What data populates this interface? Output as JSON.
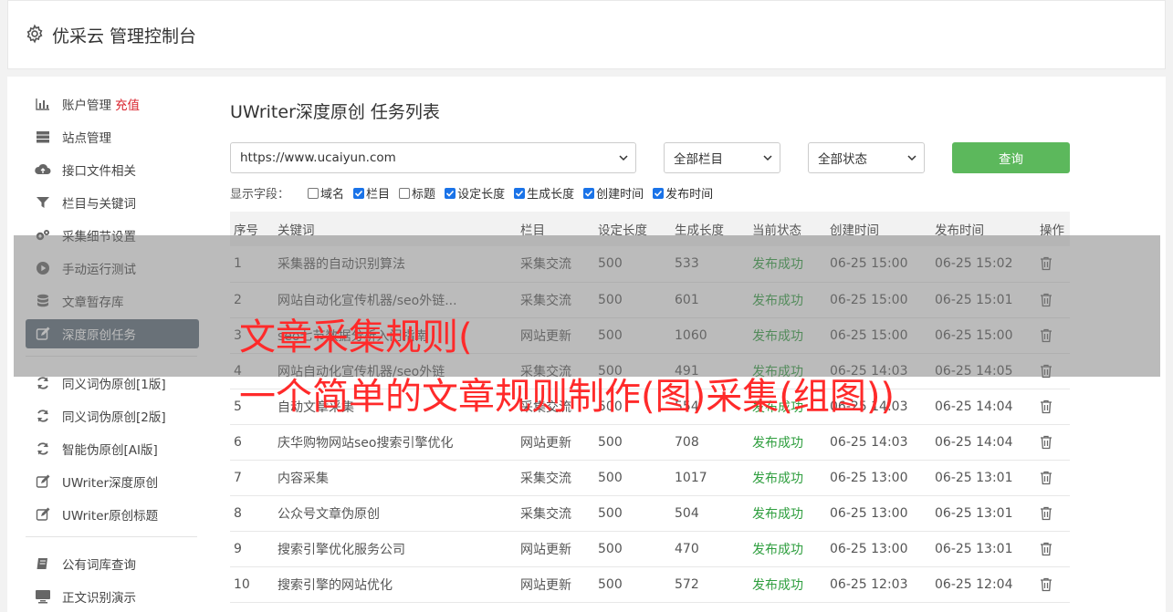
{
  "header": {
    "title": "优采云 管理控制台",
    "icon": "gear-icon"
  },
  "sidebar": {
    "group1": [
      {
        "label": "账户管理",
        "extra": "充值",
        "icon": "bar-chart-icon"
      },
      {
        "label": "站点管理",
        "icon": "server-icon"
      },
      {
        "label": "接口文件相关",
        "icon": "cloud-upload-icon"
      },
      {
        "label": "栏目与关键词",
        "icon": "filter-icon"
      },
      {
        "label": "采集细节设置",
        "icon": "gears-icon"
      },
      {
        "label": "手动运行测试",
        "icon": "play-circle-icon"
      },
      {
        "label": "文章暂存库",
        "icon": "database-icon"
      },
      {
        "label": "深度原创任务",
        "icon": "edit-icon",
        "active": true
      }
    ],
    "group2": [
      {
        "label": "同义词伪原创[1版]",
        "icon": "refresh-icon"
      },
      {
        "label": "同义词伪原创[2版]",
        "icon": "refresh-icon"
      },
      {
        "label": "智能伪原创[AI版]",
        "icon": "refresh-icon"
      },
      {
        "label": "UWriter深度原创",
        "icon": "edit-icon"
      },
      {
        "label": "UWriter原创标题",
        "icon": "edit-icon"
      }
    ],
    "group3": [
      {
        "label": "公有词库查询",
        "icon": "book-icon"
      },
      {
        "label": "正文识别演示",
        "icon": "monitor-icon"
      }
    ]
  },
  "main": {
    "title": "UWriter深度原创 任务列表",
    "site_select": "https://www.ucaiyun.com",
    "column_select": "全部栏目",
    "status_select": "全部状态",
    "query_button": "查询",
    "fields_label": "显示字段：",
    "fields": [
      {
        "label": "域名",
        "checked": false
      },
      {
        "label": "栏目",
        "checked": true
      },
      {
        "label": "标题",
        "checked": false
      },
      {
        "label": "设定长度",
        "checked": true
      },
      {
        "label": "生成长度",
        "checked": true
      },
      {
        "label": "创建时间",
        "checked": true
      },
      {
        "label": "发布时间",
        "checked": true
      }
    ],
    "table": {
      "headers": [
        "序号",
        "关键词",
        "栏目",
        "设定长度",
        "生成长度",
        "当前状态",
        "创建时间",
        "发布时间",
        "操作"
      ],
      "rows": [
        [
          "1",
          "采集器的自动识别算法",
          "采集交流",
          "500",
          "533",
          "发布成功",
          "06-25 15:00",
          "06-25 15:02"
        ],
        [
          "2",
          "网站自动化宣传机器/seo外链...",
          "采集交流",
          "500",
          "601",
          "发布成功",
          "06-25 15:00",
          "06-25 15:01"
        ],
        [
          "3",
          "seo七节数据分析入门指南",
          "网站更新",
          "500",
          "1060",
          "发布成功",
          "06-25 15:00",
          "06-25 15:00"
        ],
        [
          "4",
          "网站自动化宣传机器/seo外链",
          "采集交流",
          "500",
          "491",
          "发布成功",
          "06-25 14:03",
          "06-25 14:05"
        ],
        [
          "5",
          "自动文章采集",
          "采集交流",
          "500",
          "554",
          "发布成功",
          "06-25 14:03",
          "06-25 14:04"
        ],
        [
          "6",
          "庆华购物网站seo搜索引擎优化",
          "网站更新",
          "500",
          "708",
          "发布成功",
          "06-25 14:03",
          "06-25 14:04"
        ],
        [
          "7",
          "内容采集",
          "采集交流",
          "500",
          "1017",
          "发布成功",
          "06-25 13:00",
          "06-25 13:01"
        ],
        [
          "8",
          "公众号文章伪原创",
          "采集交流",
          "500",
          "504",
          "发布成功",
          "06-25 13:00",
          "06-25 13:01"
        ],
        [
          "9",
          "搜索引擎优化服务公司",
          "网站更新",
          "500",
          "470",
          "发布成功",
          "06-25 13:00",
          "06-25 13:01"
        ],
        [
          "10",
          "搜索引擎的网站优化",
          "网站更新",
          "500",
          "572",
          "发布成功",
          "06-25 12:03",
          "06-25 12:04"
        ]
      ]
    }
  },
  "overlay": {
    "line1": "文章采集规则(",
    "line2": "一个简单的文章规则制作(图)采集(组图))"
  },
  "colors": {
    "accent_green": "#5cb85c",
    "status_green": "#2e9e3e",
    "overlay_text": "#ff2a2a",
    "active_nav": "#5b6b79"
  }
}
